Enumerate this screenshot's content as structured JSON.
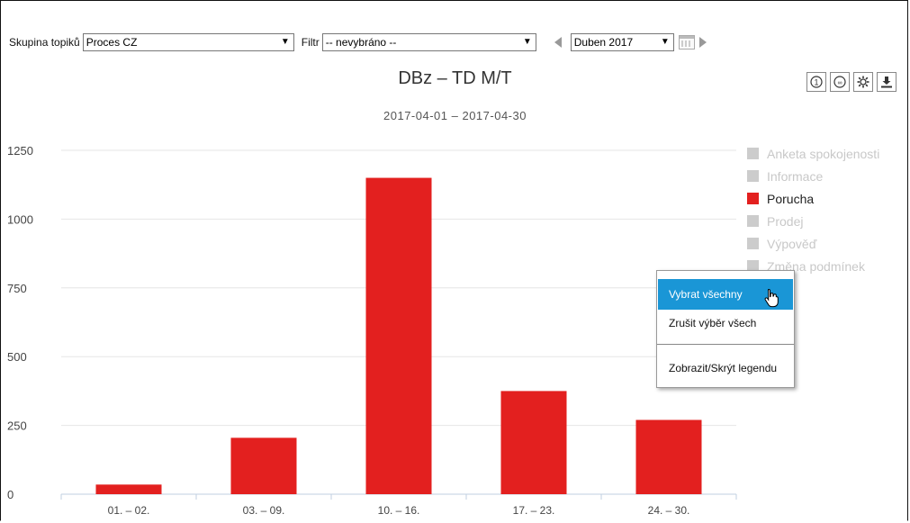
{
  "toolbar": {
    "topic_label": "Skupina topiků",
    "topic_value": "Proces CZ",
    "filter_label": "Filtr",
    "filter_value": "-- nevybráno --",
    "month_value": "Duben 2017"
  },
  "icons": [
    "caret-down",
    "arrow-left",
    "calendar",
    "arrow-right",
    "reset-1",
    "reset-2",
    "settings-gear",
    "download"
  ],
  "context_menu": {
    "items": [
      {
        "label": "Vybrat všechny",
        "active": true
      },
      {
        "label": "Zrušit výběr všech",
        "active": false
      },
      {
        "label": "Zobrazit/Skrýt legendu",
        "active": false
      }
    ]
  },
  "chart_data": {
    "type": "bar",
    "title": "DBz – TD M/T",
    "subtitle": "2017-04-01 – 2017-04-30",
    "categories": [
      "01. – 02.",
      "03. – 09.",
      "10. – 16.",
      "17. – 23.",
      "24. – 30."
    ],
    "series": [
      {
        "name": "Porucha",
        "values": [
          35,
          205,
          1150,
          375,
          270
        ],
        "color": "#e3201f"
      }
    ],
    "legend": {
      "placement": "right",
      "items": [
        {
          "label": "Anketa spokojenosti",
          "enabled": false
        },
        {
          "label": "Informace",
          "enabled": false
        },
        {
          "label": "Porucha",
          "enabled": true
        },
        {
          "label": "Prodej",
          "enabled": false
        },
        {
          "label": "Výpověď",
          "enabled": false
        },
        {
          "label": "Změna podmínek",
          "enabled": false
        }
      ]
    },
    "ylim": [
      0,
      1250
    ],
    "yticks": [
      "0",
      "250",
      "500",
      "750",
      "1000",
      "1250"
    ],
    "xlabel": "",
    "ylabel": "",
    "grid": true,
    "colors": {
      "bar": "#e3201f",
      "disabled_legend": "#cccccc",
      "grid": "#e6e6e6"
    }
  }
}
